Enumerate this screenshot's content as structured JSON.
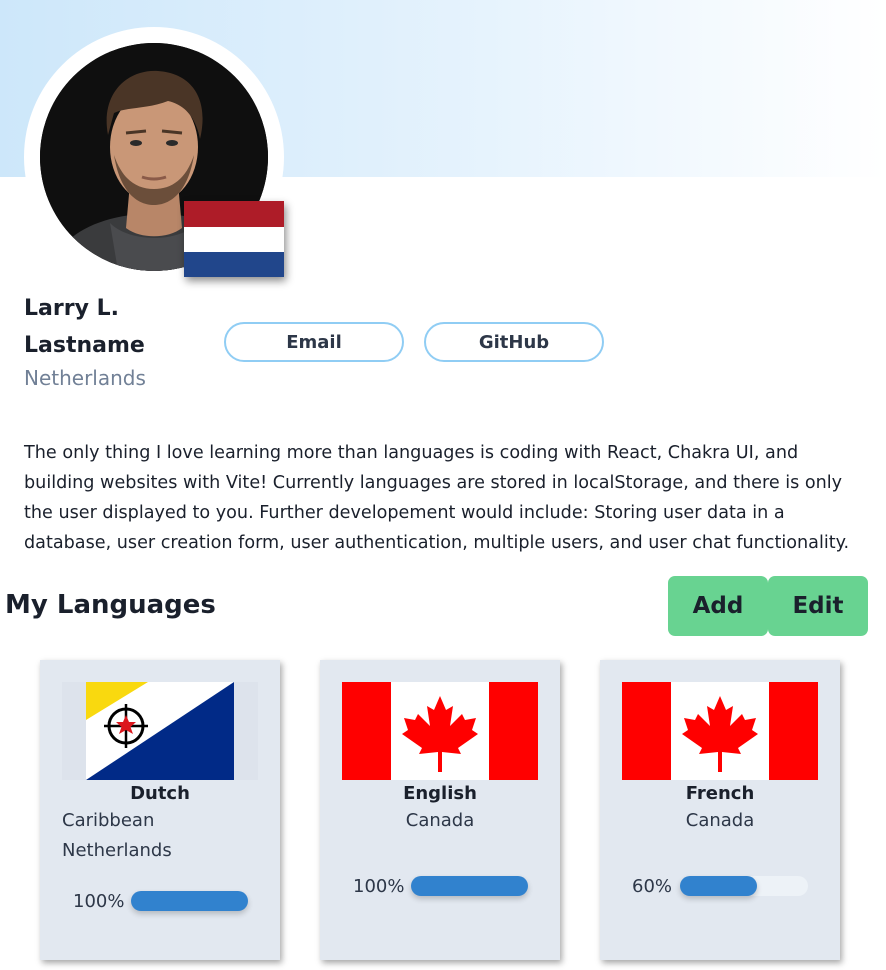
{
  "profile": {
    "name": "Larry L. Lastname",
    "location": "Netherlands",
    "badge_flag": "flag-netherlands",
    "bio": "The only thing I love learning more than languages is coding with React, Chakra UI, and building websites with Vite! Currently languages are stored in localStorage, and there is only the user displayed to you. Further developement would include: Storing user data in a database, user creation form, user authentication, multiple users, and user chat functionality."
  },
  "links": {
    "email_label": "Email",
    "github_label": "GitHub"
  },
  "languages_section": {
    "title": "My Languages",
    "add_label": "Add",
    "edit_label": "Edit"
  },
  "languages": [
    {
      "language": "Dutch",
      "region": "Caribbean Netherlands",
      "progress_label": "100%",
      "progress": 100,
      "flag": "flag-caribbean-netherlands"
    },
    {
      "language": "English",
      "region": "Canada",
      "progress_label": "100%",
      "progress": 100,
      "flag": "flag-canada"
    },
    {
      "language": "French",
      "region": "Canada",
      "progress_label": "60%",
      "progress": 60,
      "flag": "flag-canada"
    }
  ],
  "colors": {
    "accent_green": "#68d391",
    "progress_blue": "#3182ce",
    "card_bg": "#e2e8f0",
    "pill_border": "#90cdf4"
  }
}
